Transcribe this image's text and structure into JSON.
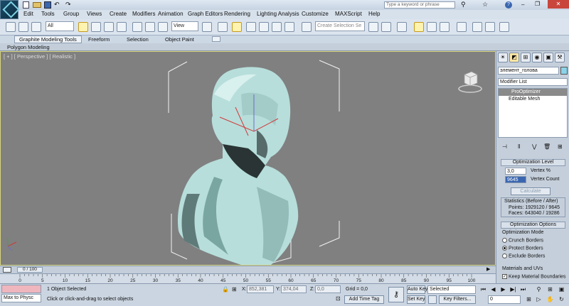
{
  "search": {
    "placeholder": "Type a keyword or phrase"
  },
  "menu": [
    "Edit",
    "Tools",
    "Group",
    "Views",
    "Create",
    "Modifiers",
    "Animation",
    "Graph Editors",
    "Rendering",
    "Lighting Analysis",
    "Customize",
    "MAXScript",
    "Help"
  ],
  "toolbar": {
    "filter_value": "All",
    "view_value": "View",
    "selection_set_placeholder": "Create Selection Se"
  },
  "ribbon": {
    "tabs": [
      "Graphite Modeling Tools",
      "Freeform",
      "Selection",
      "Object Paint"
    ],
    "sub": "Polygon Modeling"
  },
  "viewport": {
    "label": "[ + ] [ Perspective ] [ Realistic ]"
  },
  "command_panel": {
    "object_name": "элемент_голова",
    "modifier_list": "Modifier List",
    "stack": [
      "ProOptimizer",
      "Editable Mesh"
    ],
    "optimization_level_title": "Optimization Level",
    "vertex_percent_value": "3,0",
    "vertex_percent_label": "Vertex %",
    "vertex_count_value": "9645",
    "vertex_count_label": "Vertex Count",
    "calculate_label": "Calculate",
    "stats_title": "Statistics (Before / After)",
    "stats_points": "Points: 1929120 / 9645",
    "stats_faces": "Faces: 643040 / 19286",
    "opt_options_title": "Optimization Options",
    "opt_mode_label": "Optimization Mode",
    "modes": [
      "Crunch Borders",
      "Protect Borders",
      "Exclude Borders"
    ],
    "selected_mode_index": 1,
    "materials_label": "Materials and UVs",
    "keep_material_label": "Keep Material Boundaries"
  },
  "timeline": {
    "slider_label": "0 / 100",
    "ticks": [
      "0",
      "5",
      "10",
      "15",
      "20",
      "25",
      "30",
      "35",
      "40",
      "45",
      "50",
      "55",
      "60",
      "65",
      "70",
      "75",
      "80",
      "85",
      "90",
      "95",
      "100"
    ]
  },
  "status": {
    "script_text": "Max to Physc",
    "selected_text": "1 Object Selected",
    "prompt_text": "Click or click-and-drag to select objects",
    "x_label": "X:",
    "x_value": "852,381",
    "y_label": "Y:",
    "y_value": "374,04",
    "z_label": "Z:",
    "z_value": "0,0",
    "grid_text": "Grid = 0,0",
    "add_time_tag": "Add Time Tag",
    "auto_key": "Auto Key",
    "set_key": "Set Key",
    "key_mode_value": "Selected",
    "key_filters": "Key Filters...",
    "frame_value": "0"
  },
  "colors": {
    "viewport_bg": "#808080",
    "bust": "#b7dedb",
    "selection_accent": "#ffd34a"
  }
}
